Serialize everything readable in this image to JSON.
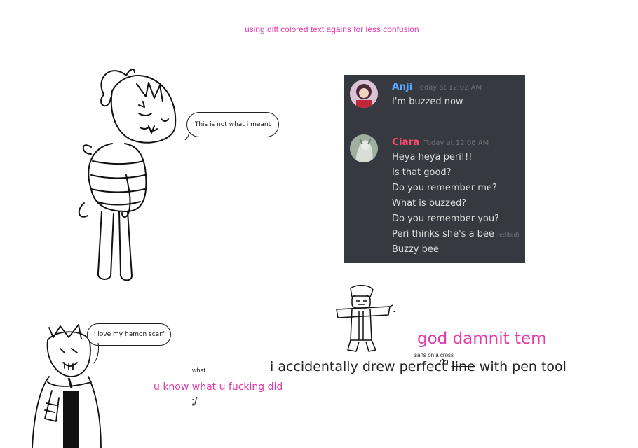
{
  "header_note": "using diff colored text agains for less confusion",
  "speech_top": "This is not what i meant",
  "speech_bottom": "i love my hamon scarf",
  "chat": {
    "messages": [
      {
        "author": "Anji",
        "author_color": "#5aa8ff",
        "timestamp": "Today at 12:02 AM",
        "lines": [
          {
            "text": "I'm buzzed now",
            "edited": ""
          }
        ]
      },
      {
        "author": "Ciara",
        "author_color": "#ff4a6b",
        "timestamp": "Today at 12:06 AM",
        "lines": [
          {
            "text": "Heya heya peri!!!",
            "edited": ""
          },
          {
            "text": "Is that good?",
            "edited": ""
          },
          {
            "text": "Do you remember me?",
            "edited": ""
          },
          {
            "text": "What is buzzed?",
            "edited": ""
          },
          {
            "text": "Do you remember you?",
            "edited": ""
          },
          {
            "text": "Peri thinks she's a bee",
            "edited": "(edited)"
          },
          {
            "text": "Buzzy bee",
            "edited": ""
          }
        ]
      }
    ]
  },
  "captions": {
    "god_damnit": "god damnit tem",
    "sans_note": "sans on a cross",
    "accident_prefix": "i accidentally drew perfect ",
    "accident_struck": "line",
    "accident_suffix": " with pen tool",
    "what": "what",
    "u_know": "u know what u fucking did",
    "emoticon": ";/"
  },
  "colors": {
    "magenta": "#e23aa8",
    "discord_bg": "#36393f",
    "discord_text": "#dcddde"
  }
}
